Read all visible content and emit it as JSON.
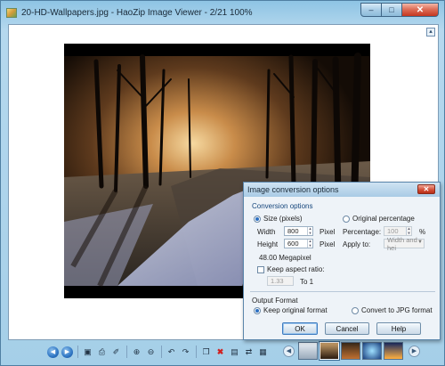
{
  "window": {
    "title": "20-HD-Wallpapers.jpg - HaoZip Image Viewer - 2/21 100%",
    "minimize_glyph": "–",
    "maximize_glyph": "□",
    "close_glyph": "✕",
    "corner_glyph": "▴"
  },
  "image": {
    "description_icon": "winter-forest-photo"
  },
  "toolbar": {
    "icons": [
      "previous-icon",
      "next-icon",
      "fit-window-icon",
      "print-icon",
      "delete-icon",
      "zoom-in-icon",
      "zoom-out-icon",
      "rotate-left-icon",
      "rotate-right-icon",
      "copy-icon",
      "close-red-icon",
      "slideshow-icon",
      "convert-icon",
      "wallpaper-icon"
    ],
    "glyphs": {
      "prev": "◀",
      "next": "▶",
      "fit": "▣",
      "print": "⎙",
      "del": "✐",
      "zoomin": "⊕",
      "zoomout": "⊖",
      "rotl": "↶",
      "rotr": "↷",
      "copy": "❐",
      "x": "✖",
      "slide": "▤",
      "conv": "⇄",
      "wall": "▦"
    },
    "thumb_prev": "◀",
    "thumb_next": "▶"
  },
  "dialog": {
    "title": "Image conversion options",
    "close_glyph": "✕",
    "conversion_options_label": "Conversion options",
    "size_pixels_label": "Size (pixels)",
    "original_percentage_label": "Original percentage",
    "width_label": "Width",
    "width_value": "800",
    "height_label": "Height",
    "height_value": "600",
    "pixel_unit_1": "Pixel",
    "pixel_unit_2": "Pixel",
    "percentage_label": "Percentage:",
    "percentage_value": "100",
    "percent_unit": "%",
    "apply_to_label": "Apply to:",
    "apply_to_value": "Width and hei",
    "megapixel_text": "48.00 Megapixel",
    "keep_aspect_label": "Keep aspect ratio:",
    "aspect_value": "1.33",
    "to_one_label": "To 1",
    "output_format_label": "Output Format",
    "keep_original_label": "Keep original format",
    "convert_jpg_label": "Convert to JPG format",
    "ok_label": "OK",
    "cancel_label": "Cancel",
    "help_label": "Help",
    "spin_up": "▲",
    "spin_down": "▼",
    "select_arrow": "▼"
  },
  "colors": {
    "accent": "#2a6fc2",
    "group_label": "#15467c",
    "close_red": "#d14b33"
  }
}
